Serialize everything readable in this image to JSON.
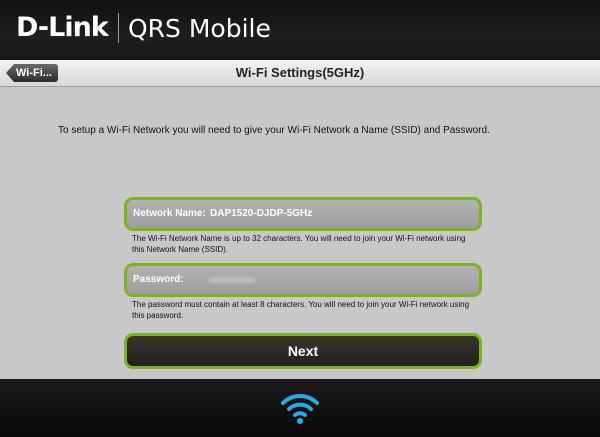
{
  "header": {
    "brand": "D-Link",
    "product": "QRS Mobile"
  },
  "titlebar": {
    "back_label": "Wi-Fi...",
    "title": "Wi-Fi Settings(5GHz)"
  },
  "main": {
    "intro": "To setup a Wi-Fi Network you will need to give your Wi-Fi Network a Name (SSID) and Password.",
    "network_name": {
      "label": "Network Name:",
      "value": "DAP1520-DJDP-5GHz",
      "help": "The Wi-Fi Network Name is up to 32 characters. You will need to join your Wi-Fi network using this Network Name (SSID)."
    },
    "password": {
      "label": "Password:",
      "help": "The password must contain at least 8 characters.  You will need to join your Wi-Fi network using this password."
    },
    "next_label": "Next"
  },
  "footer": {
    "icon": "wifi-icon"
  },
  "colors": {
    "accent_green": "#7ab51d",
    "wifi_blue": "#2aa8e8"
  }
}
